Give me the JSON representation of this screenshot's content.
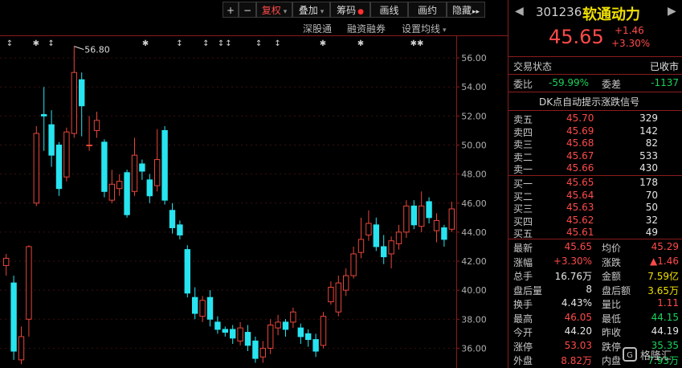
{
  "toolbar": {
    "plus": "+",
    "minus": "−",
    "fuquan": "复权",
    "diejia": "叠加",
    "chouma": "筹码",
    "huaxian": "画线",
    "huayue": "画约",
    "yincang": "隐藏",
    "more": "▸▸"
  },
  "chart_header": {
    "shengutong": "深股通",
    "rongzi": "融资融券",
    "junxian": "设置均线"
  },
  "chart_data": {
    "type": "candlestick",
    "yticks": [
      "56.00",
      "54.00",
      "52.00",
      "50.00",
      "48.00",
      "46.00",
      "44.00",
      "42.00",
      "40.00",
      "38.00",
      "36.00"
    ],
    "ylim": [
      34.75,
      57.5
    ],
    "peak_label": "56.80",
    "markers": [
      "↕",
      "✱",
      "↕",
      "✱",
      "↕",
      "↕",
      "↕",
      "↕",
      "↕",
      "↕",
      "✱",
      "✱",
      "✱✱"
    ],
    "colors": {
      "up": "#e8463a",
      "down": "#27e4f0"
    },
    "candles": [
      {
        "o": 41.7,
        "c": 42.2,
        "h": 42.5,
        "l": 41.0
      },
      {
        "o": 40.5,
        "c": 35.8,
        "h": 41.0,
        "l": 35.2
      },
      {
        "o": 35.2,
        "c": 36.8,
        "h": 37.5,
        "l": 34.9
      },
      {
        "o": 38.0,
        "c": 43.0,
        "h": 43.1,
        "l": 36.8
      },
      {
        "o": 46.0,
        "c": 50.8,
        "h": 51.3,
        "l": 45.8
      },
      {
        "o": 52.1,
        "c": 52.0,
        "h": 54.0,
        "l": 49.6
      },
      {
        "o": 51.4,
        "c": 49.3,
        "h": 52.4,
        "l": 48.5
      },
      {
        "o": 50.0,
        "c": 47.0,
        "h": 50.2,
        "l": 46.5
      },
      {
        "o": 47.8,
        "c": 50.9,
        "h": 51.2,
        "l": 47.5
      },
      {
        "o": 50.8,
        "c": 55.0,
        "h": 56.8,
        "l": 50.5
      },
      {
        "o": 54.5,
        "c": 52.7,
        "h": 55.0,
        "l": 50.6
      },
      {
        "o": 50.0,
        "c": 50.0,
        "h": 52.0,
        "l": 49.6
      },
      {
        "o": 51.0,
        "c": 51.7,
        "h": 52.3,
        "l": 50.5
      },
      {
        "o": 50.2,
        "c": 46.8,
        "h": 50.4,
        "l": 46.4
      },
      {
        "o": 46.2,
        "c": 47.3,
        "h": 48.3,
        "l": 46.0
      },
      {
        "o": 47.0,
        "c": 47.5,
        "h": 48.0,
        "l": 46.5
      },
      {
        "o": 48.1,
        "c": 45.2,
        "h": 48.3,
        "l": 45.0
      },
      {
        "o": 46.8,
        "c": 49.3,
        "h": 50.5,
        "l": 46.5
      },
      {
        "o": 48.7,
        "c": 48.2,
        "h": 49.0,
        "l": 47.6
      },
      {
        "o": 47.6,
        "c": 46.5,
        "h": 48.0,
        "l": 46.0
      },
      {
        "o": 47.2,
        "c": 49.0,
        "h": 51.1,
        "l": 46.8
      },
      {
        "o": 51.0,
        "c": 46.2,
        "h": 51.3,
        "l": 45.9
      },
      {
        "o": 45.5,
        "c": 44.3,
        "h": 46.0,
        "l": 43.9
      },
      {
        "o": 44.5,
        "c": 43.8,
        "h": 44.8,
        "l": 43.5
      },
      {
        "o": 42.8,
        "c": 39.8,
        "h": 43.1,
        "l": 39.5
      },
      {
        "o": 39.5,
        "c": 38.4,
        "h": 40.2,
        "l": 38.0
      },
      {
        "o": 38.2,
        "c": 39.3,
        "h": 39.6,
        "l": 37.8
      },
      {
        "o": 39.5,
        "c": 38.0,
        "h": 40.0,
        "l": 37.5
      },
      {
        "o": 37.8,
        "c": 37.3,
        "h": 38.2,
        "l": 37.0
      },
      {
        "o": 37.3,
        "c": 37.1,
        "h": 37.5,
        "l": 36.8
      },
      {
        "o": 37.3,
        "c": 36.7,
        "h": 37.6,
        "l": 36.3
      },
      {
        "o": 36.5,
        "c": 37.4,
        "h": 37.8,
        "l": 36.2
      },
      {
        "o": 37.1,
        "c": 36.2,
        "h": 37.6,
        "l": 35.8
      },
      {
        "o": 36.5,
        "c": 35.3,
        "h": 36.8,
        "l": 35.0
      },
      {
        "o": 35.4,
        "c": 36.0,
        "h": 36.5,
        "l": 35.0
      },
      {
        "o": 36.0,
        "c": 37.6,
        "h": 38.0,
        "l": 35.6
      },
      {
        "o": 37.4,
        "c": 37.8,
        "h": 38.3,
        "l": 36.9
      },
      {
        "o": 37.8,
        "c": 37.3,
        "h": 38.0,
        "l": 36.8
      },
      {
        "o": 37.8,
        "c": 38.5,
        "h": 38.8,
        "l": 37.4
      },
      {
        "o": 37.4,
        "c": 36.8,
        "h": 37.7,
        "l": 36.3
      },
      {
        "o": 37.0,
        "c": 36.6,
        "h": 37.3,
        "l": 36.1
      },
      {
        "o": 36.6,
        "c": 35.8,
        "h": 37.0,
        "l": 35.4
      },
      {
        "o": 36.2,
        "c": 38.2,
        "h": 38.5,
        "l": 36.0
      },
      {
        "o": 39.2,
        "c": 40.2,
        "h": 40.6,
        "l": 39.0
      },
      {
        "o": 38.5,
        "c": 40.5,
        "h": 41.0,
        "l": 38.2
      },
      {
        "o": 40.0,
        "c": 41.0,
        "h": 41.5,
        "l": 39.6
      },
      {
        "o": 41.0,
        "c": 42.5,
        "h": 43.0,
        "l": 40.8
      },
      {
        "o": 42.6,
        "c": 43.5,
        "h": 45.0,
        "l": 42.2
      },
      {
        "o": 43.8,
        "c": 44.6,
        "h": 45.5,
        "l": 43.4
      },
      {
        "o": 44.5,
        "c": 43.0,
        "h": 45.0,
        "l": 42.7
      },
      {
        "o": 43.0,
        "c": 42.3,
        "h": 43.8,
        "l": 41.8
      },
      {
        "o": 42.5,
        "c": 43.4,
        "h": 43.7,
        "l": 41.5
      },
      {
        "o": 43.2,
        "c": 44.0,
        "h": 44.5,
        "l": 42.8
      },
      {
        "o": 44.0,
        "c": 45.8,
        "h": 46.2,
        "l": 43.6
      },
      {
        "o": 45.8,
        "c": 44.5,
        "h": 46.2,
        "l": 44.2
      },
      {
        "o": 44.4,
        "c": 45.8,
        "h": 46.8,
        "l": 44.0
      },
      {
        "o": 46.1,
        "c": 45.0,
        "h": 46.4,
        "l": 44.6
      },
      {
        "o": 44.1,
        "c": 44.8,
        "h": 45.3,
        "l": 43.3
      },
      {
        "o": 44.3,
        "c": 43.5,
        "h": 44.5,
        "l": 43.0
      },
      {
        "o": 44.2,
        "c": 45.6,
        "h": 46.1,
        "l": 44.0
      }
    ]
  },
  "stock": {
    "code": "301236",
    "name": "软通动力",
    "price": "45.65",
    "change": "+1.46",
    "change_pct": "+3.30%"
  },
  "status": {
    "label": "交易状态",
    "value": "已收市",
    "weibi_label": "委比",
    "weibi_value": "-59.99%",
    "weicha_label": "委差",
    "weicha_value": "-1137",
    "dk_link": "DK点自动提示涨跌信号"
  },
  "sell_orders": [
    {
      "label": "卖五",
      "price": "45.70",
      "vol": "329"
    },
    {
      "label": "卖四",
      "price": "45.69",
      "vol": "142"
    },
    {
      "label": "卖三",
      "price": "45.68",
      "vol": "82"
    },
    {
      "label": "卖二",
      "price": "45.67",
      "vol": "533"
    },
    {
      "label": "卖一",
      "price": "45.66",
      "vol": "430"
    }
  ],
  "buy_orders": [
    {
      "label": "买一",
      "price": "45.65",
      "vol": "178"
    },
    {
      "label": "买二",
      "price": "45.64",
      "vol": "70"
    },
    {
      "label": "买三",
      "price": "45.63",
      "vol": "50"
    },
    {
      "label": "买四",
      "price": "45.62",
      "vol": "32"
    },
    {
      "label": "买五",
      "price": "45.61",
      "vol": "49"
    }
  ],
  "stats": [
    {
      "l1": "最新",
      "v1": "45.65",
      "c1": "red",
      "l2": "均价",
      "v2": "45.29",
      "c2": "red"
    },
    {
      "l1": "涨幅",
      "v1": "+3.30%",
      "c1": "red",
      "l2": "涨跌",
      "v2": "▲1.46",
      "c2": "red"
    },
    {
      "l1": "总手",
      "v1": "16.76万",
      "c1": "white",
      "l2": "金额",
      "v2": "7.59亿",
      "c2": "yellow"
    },
    {
      "l1": "盘后量",
      "v1": "8",
      "c1": "white",
      "l2": "盘后额",
      "v2": "3.65万",
      "c2": "yellow"
    },
    {
      "l1": "换手",
      "v1": "4.43%",
      "c1": "white",
      "l2": "量比",
      "v2": "1.11",
      "c2": "red"
    },
    {
      "l1": "最高",
      "v1": "46.05",
      "c1": "red",
      "l2": "最低",
      "v2": "44.15",
      "c2": "green"
    },
    {
      "l1": "今开",
      "v1": "44.20",
      "c1": "white",
      "l2": "昨收",
      "v2": "44.19",
      "c2": "white"
    },
    {
      "l1": "涨停",
      "v1": "53.03",
      "c1": "red",
      "l2": "跌停",
      "v2": "35.35",
      "c2": "green"
    },
    {
      "l1": "外盘",
      "v1": "8.82万",
      "c1": "red",
      "l2": "内盘",
      "v2": "7.93万",
      "c2": "green"
    }
  ],
  "watermark": "格隆汇"
}
